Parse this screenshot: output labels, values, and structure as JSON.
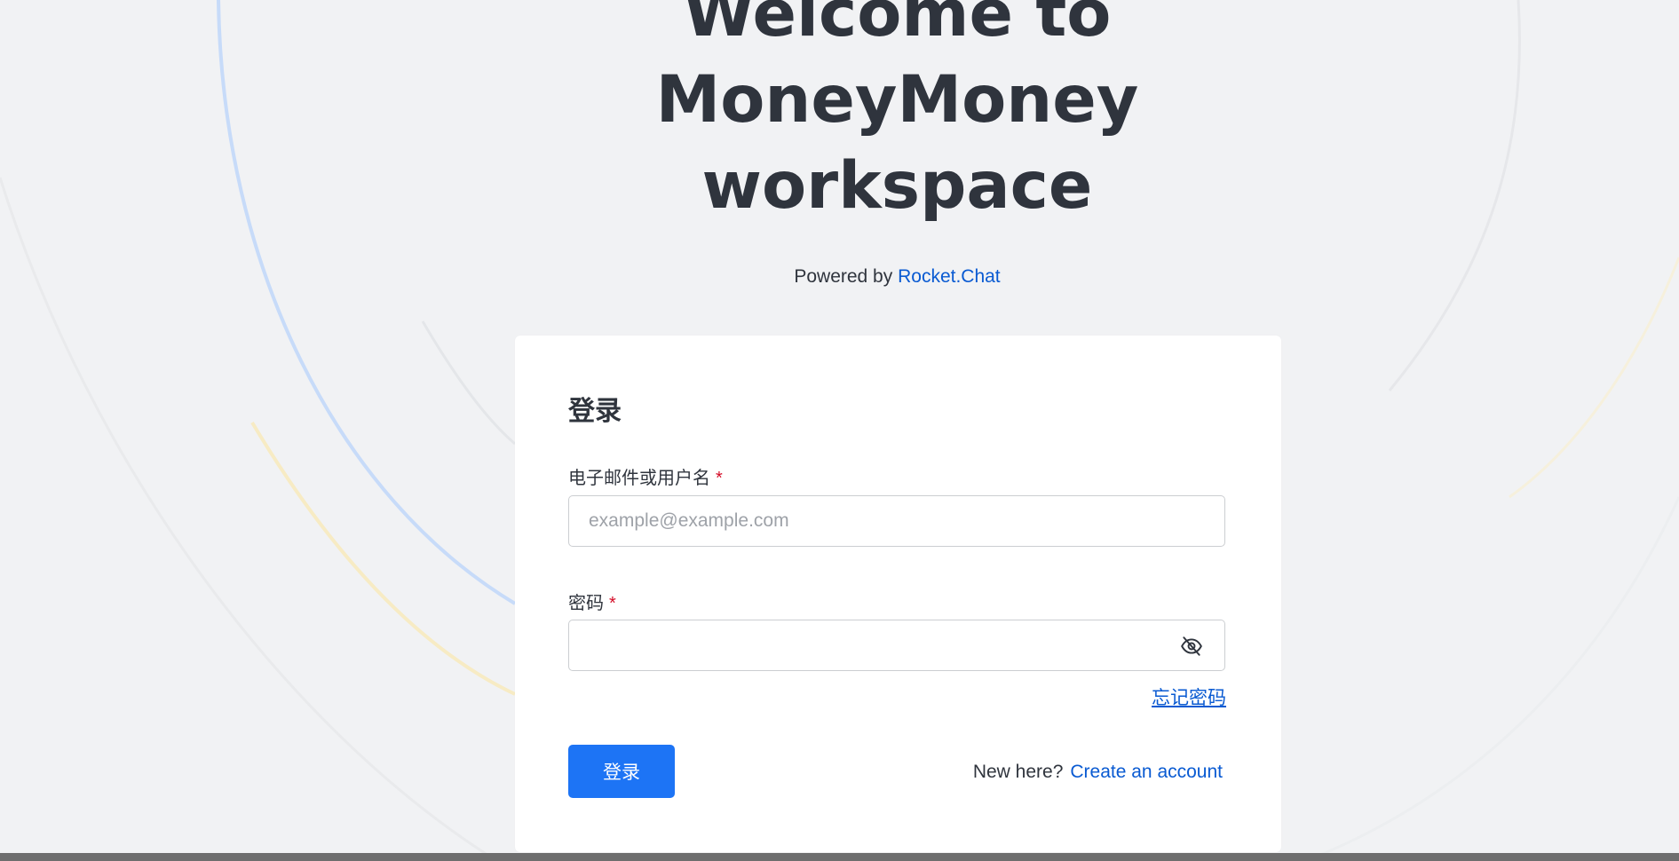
{
  "hero": {
    "line1": "Welcome to",
    "line2": "MoneyMoney",
    "line3": "workspace"
  },
  "powered": {
    "prefix": "Powered by",
    "link": "Rocket.Chat"
  },
  "login": {
    "title": "登录",
    "email_label": "电子邮件或用户名",
    "email_placeholder": "example@example.com",
    "email_value": "",
    "password_label": "密码",
    "password_value": "",
    "required_mark": "*",
    "forgot_label": "忘记密码",
    "submit_label": "登录",
    "new_here": "New here?",
    "create_account": "Create an account"
  },
  "icons": {
    "password_toggle": "eye-off-icon"
  },
  "colors": {
    "background": "#f1f2f4",
    "primary": "#1d74f5",
    "link": "#095ad2",
    "required": "#d40c26",
    "text": "#2f343d"
  }
}
